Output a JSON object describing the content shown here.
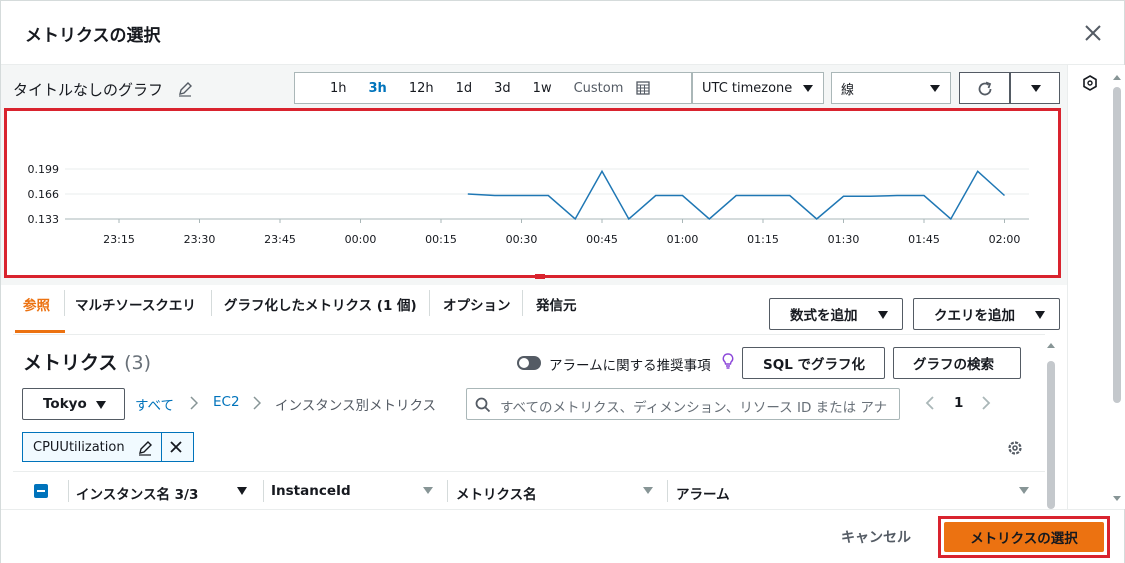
{
  "modal": {
    "title": "メトリクスの選択"
  },
  "graph": {
    "title": "タイトルなしのグラフ",
    "time_ranges": [
      "1h",
      "3h",
      "12h",
      "1d",
      "3d",
      "1w"
    ],
    "active_range": "3h",
    "custom_label": "Custom",
    "timezone": "UTC timezone",
    "chart_style": "線"
  },
  "chart_data": {
    "type": "line",
    "x_ticks": [
      "23:15",
      "23:30",
      "23:45",
      "00:00",
      "00:15",
      "00:30",
      "00:45",
      "01:00",
      "01:15",
      "01:30",
      "01:45",
      "02:00"
    ],
    "y_ticks": [
      "0.199",
      "0.166",
      "0.133"
    ],
    "ylim": [
      0.133,
      0.199
    ],
    "series": [
      {
        "color": "#1f77b4",
        "x": [
          "00:20",
          "00:25",
          "00:30",
          "00:35",
          "00:40",
          "00:45",
          "00:50",
          "00:55",
          "01:00",
          "01:05",
          "01:10",
          "01:15",
          "01:20",
          "01:25",
          "01:30",
          "01:35",
          "01:40",
          "01:45",
          "01:50",
          "01:55",
          "02:00"
        ],
        "values": [
          0.166,
          0.164,
          0.164,
          0.164,
          0.133,
          0.196,
          0.133,
          0.164,
          0.164,
          0.133,
          0.164,
          0.164,
          0.164,
          0.133,
          0.163,
          0.163,
          0.164,
          0.164,
          0.133,
          0.196,
          0.164
        ]
      }
    ]
  },
  "tabs": [
    {
      "label": "参照",
      "active": true
    },
    {
      "label": "マルチソースクエリ"
    },
    {
      "label": "グラフ化したメトリクス (1 個)"
    },
    {
      "label": "オプション"
    },
    {
      "label": "発信元"
    }
  ],
  "actions": {
    "add_formula": "数式を追加",
    "add_query": "クエリを追加"
  },
  "metrics": {
    "title": "メトリクス",
    "count": "(3)",
    "alarm_toggle_label": "アラームに関する推奨事項",
    "sql_button": "SQL でグラフ化",
    "search_graph_button": "グラフの検索",
    "region": "Tokyo",
    "breadcrumb": [
      "すべて",
      "EC2",
      "インスタンス別メトリクス"
    ],
    "search_placeholder": "すべてのメトリクス、ディメンション、リソース ID または アナ",
    "page": "1",
    "token": "CPUUtilization",
    "columns": [
      "インスタンス名 3/3",
      "InstanceId",
      "メトリクス名",
      "アラーム"
    ]
  },
  "footer": {
    "cancel": "キャンセル",
    "primary": "メトリクスの選択"
  }
}
